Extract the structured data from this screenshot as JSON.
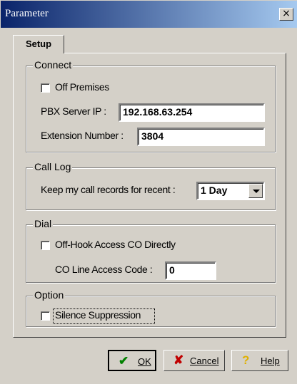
{
  "window": {
    "title": "Parameter",
    "close_glyph": "×"
  },
  "tab": {
    "label": "Setup"
  },
  "connect": {
    "legend": "Connect",
    "off_premises_label": "Off Premises",
    "off_premises_checked": false,
    "pbx_label": "PBX Server IP :",
    "pbx_value": "192.168.63.254",
    "extension_label": "Extension Number :",
    "extension_value": "3804"
  },
  "call_log": {
    "legend": "Call Log",
    "keep_label": "Keep my call records for recent :",
    "keep_value": "1 Day"
  },
  "dial": {
    "legend": "Dial",
    "offhook_label": "Off-Hook Access CO Directly",
    "offhook_checked": false,
    "co_label": "CO Line Access Code :",
    "co_value": "0"
  },
  "option": {
    "legend": "Option",
    "silence_label": "Silence Suppression",
    "silence_checked": false
  },
  "buttons": {
    "ok": {
      "label": "OK",
      "icon": "check-icon",
      "color": "#008000"
    },
    "cancel": {
      "label": "Cancel",
      "icon": "x-icon",
      "color": "#c00000"
    },
    "help": {
      "label": "Help",
      "icon": "question-icon",
      "color": "#e0b000"
    }
  }
}
